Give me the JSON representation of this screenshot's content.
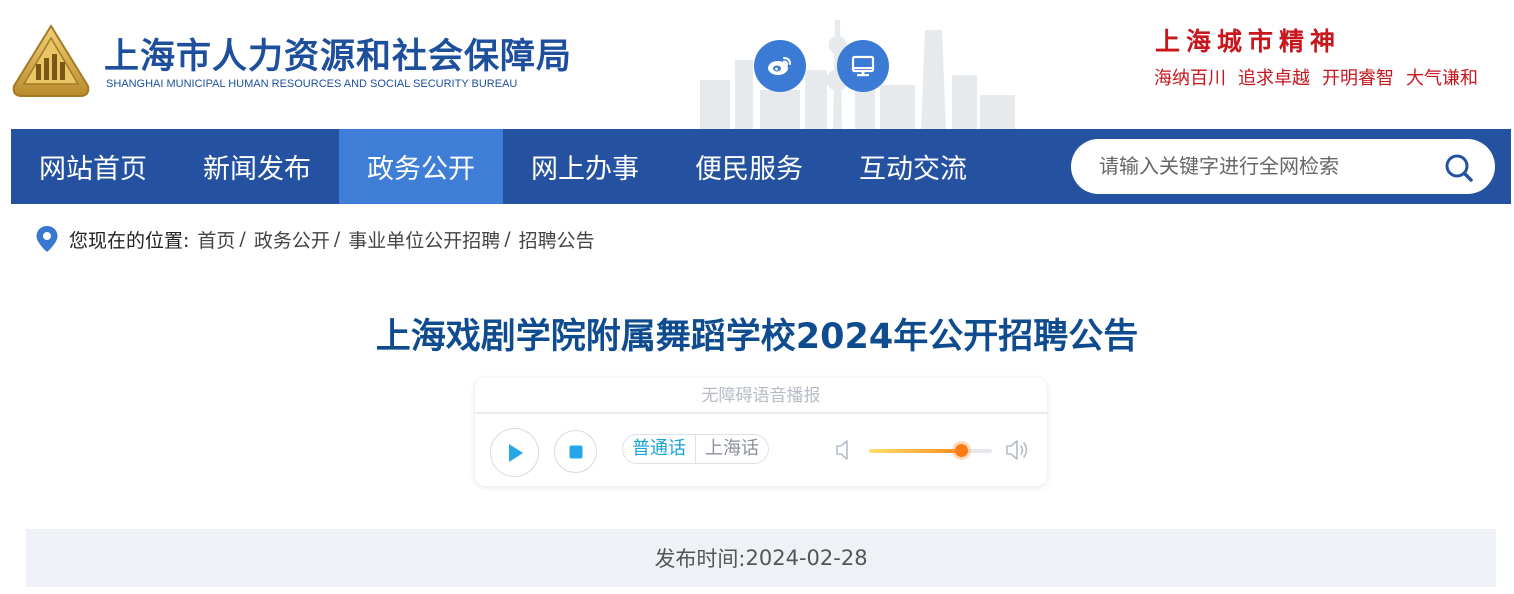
{
  "header": {
    "logo_cn": "上海市人力资源和社会保障局",
    "logo_en": "SHANGHAI MUNICIPAL HUMAN RESOURCES AND SOCIAL SECURITY BUREAU",
    "social": [
      {
        "icon": "weibo-icon"
      },
      {
        "icon": "desktop-icon"
      }
    ],
    "spirit_title": "上海城市精神",
    "spirit_words": [
      "海纳百川",
      "追求卓越",
      "开明睿智",
      "大气谦和"
    ]
  },
  "nav": {
    "items": [
      {
        "label": "网站首页"
      },
      {
        "label": "新闻发布"
      },
      {
        "label": "政务公开",
        "active": true
      },
      {
        "label": "网上办事"
      },
      {
        "label": "便民服务"
      },
      {
        "label": "互动交流"
      }
    ],
    "search_placeholder": "请输入关键字进行全网检索"
  },
  "breadcrumb": {
    "lead": "您现在的位置:",
    "items": [
      "首页",
      "政务公开",
      "事业单位公开招聘",
      "招聘公告"
    ],
    "separator": "/"
  },
  "article": {
    "title": "上海戏剧学院附属舞蹈学校2024年公开招聘公告",
    "publish_label": "发布时间:",
    "publish_date": "2024-02-28"
  },
  "player": {
    "label": "无障碍语音播报",
    "languages": [
      "普通话",
      "上海话"
    ],
    "selected_language": "普通话",
    "volume": 0.75
  },
  "colors": {
    "nav_bg": "#2452a0",
    "nav_active": "#3f7ed6",
    "title": "#0f4b8f",
    "spirit_red": "#c8161d"
  }
}
